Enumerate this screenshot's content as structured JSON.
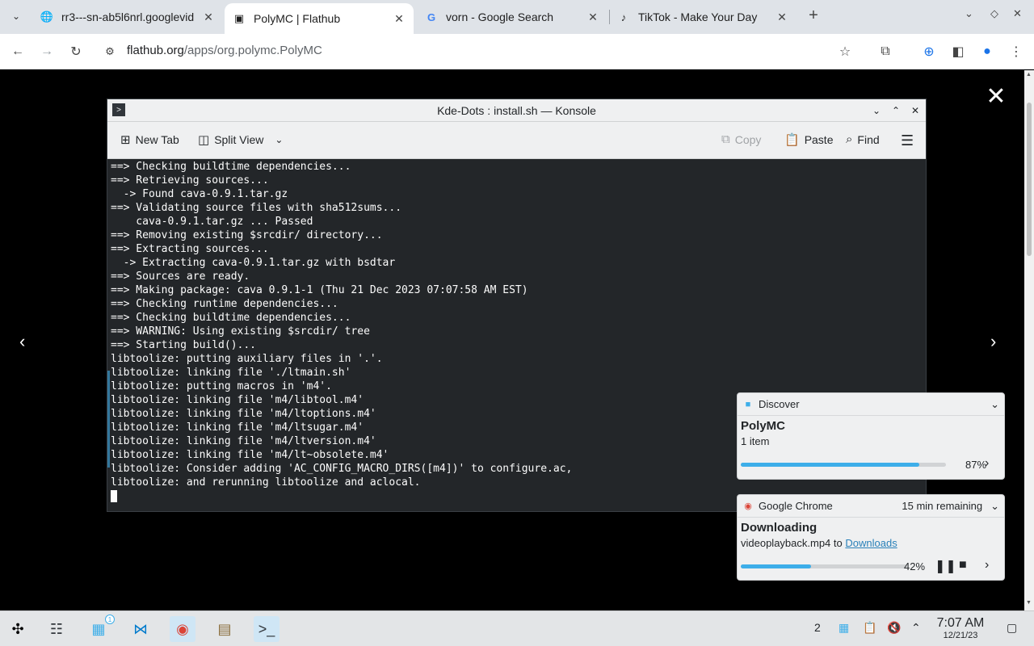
{
  "browser": {
    "tabs": [
      {
        "title": "rr3---sn-ab5l6nrl.googlevid",
        "icon": "globe-icon"
      },
      {
        "title": "PolyMC | Flathub",
        "icon": "flathub-icon"
      },
      {
        "title": "vorn - Google Search",
        "icon": "google-icon"
      },
      {
        "title": "TikTok - Make Your Day",
        "icon": "tiktok-icon"
      }
    ],
    "url_host": "flathub.org",
    "url_path": "/apps/org.polymc.PolyMC"
  },
  "konsole": {
    "title": "Kde-Dots : install.sh — Konsole",
    "toolbar": {
      "new_tab": "New Tab",
      "split_view": "Split View",
      "copy": "Copy",
      "paste": "Paste",
      "find": "Find"
    },
    "lines": [
      "==> Checking buildtime dependencies...",
      "==> Retrieving sources...",
      "  -> Found cava-0.9.1.tar.gz",
      "==> Validating source files with sha512sums...",
      "    cava-0.9.1.tar.gz ... Passed",
      "==> Removing existing $srcdir/ directory...",
      "==> Extracting sources...",
      "  -> Extracting cava-0.9.1.tar.gz with bsdtar",
      "==> Sources are ready.",
      "==> Making package: cava 0.9.1-1 (Thu 21 Dec 2023 07:07:58 AM EST)",
      "==> Checking runtime dependencies...",
      "==> Checking buildtime dependencies...",
      "==> WARNING: Using existing $srcdir/ tree",
      "==> Starting build()...",
      "libtoolize: putting auxiliary files in '.'.",
      "libtoolize: linking file './ltmain.sh'",
      "libtoolize: putting macros in 'm4'.",
      "libtoolize: linking file 'm4/libtool.m4'",
      "libtoolize: linking file 'm4/ltoptions.m4'",
      "libtoolize: linking file 'm4/ltsugar.m4'",
      "libtoolize: linking file 'm4/ltversion.m4'",
      "libtoolize: linking file 'm4/lt~obsolete.m4'",
      "libtoolize: Consider adding 'AC_CONFIG_MACRO_DIRS([m4])' to configure.ac,",
      "libtoolize: and rerunning libtoolize and aclocal."
    ]
  },
  "notifications": {
    "discover": {
      "app": "Discover",
      "title": "PolyMC",
      "body": "1 item",
      "progress_label": "87%",
      "progress": 0.87
    },
    "chrome": {
      "app": "Google Chrome",
      "eta": "15 min remaining",
      "title": "Downloading",
      "body_prefix": "videoplayback.mp4 to",
      "body_link": "Downloads",
      "progress_label": "42%",
      "progress": 0.42
    }
  },
  "taskbar": {
    "badges": {
      "discover": "1",
      "tray_count": "2"
    },
    "time": "7:07 AM",
    "date": "12/21/23"
  },
  "colors": {
    "accent": "#3daee9",
    "terminal_bg": "#232629"
  }
}
